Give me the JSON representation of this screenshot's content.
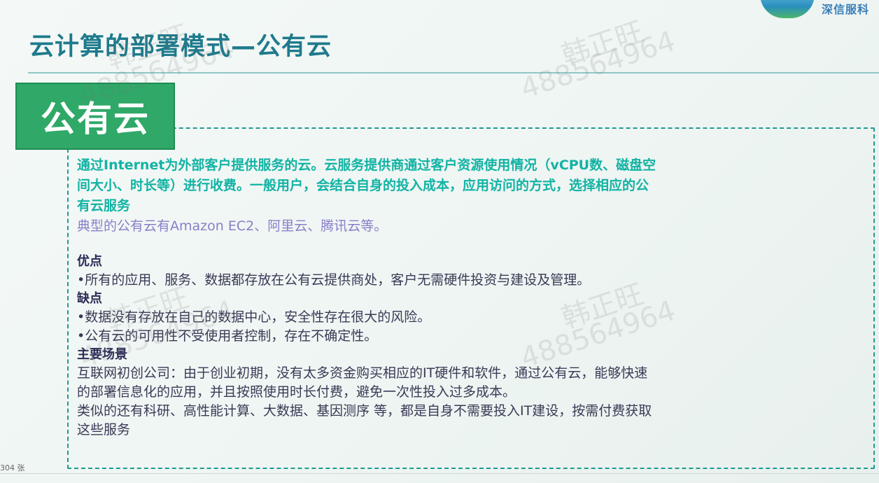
{
  "logo": {
    "text": "深信服科"
  },
  "slide": {
    "title": "云计算的部署模式—公有云",
    "tag": "公有云",
    "intro_lines": [
      "通过Internet为外部客户提供服务的云。云服务提供商通过客户资源使用情况（vCPU数、磁盘空",
      "间大小、时长等）进行收费。一般用户，会结合自身的投入成本，应用访问的方式，选择相应的公",
      "有云服务"
    ],
    "typical": "典型的公有云有Amazon EC2、阿里云、腾讯云等。",
    "pros_label": "优点",
    "pros": [
      "•所有的应用、服务、数据都存放在公有云提供商处，客户无需硬件投资与建设及管理。"
    ],
    "cons_label": "缺点",
    "cons": [
      "•数据没有存放在自己的数据中心，安全性存在很大的风险。",
      "•公有云的可用性不受使用者控制，存在不确定性。"
    ],
    "scenario_label": "主要场景",
    "scenario_lines": [
      "互联网初创公司：由于创业初期，没有太多资金购买相应的IT硬件和软件，通过公有云，能够快速",
      "的部署信息化的应用，并且按照使用时长付费，避免一次性投入过多成本。",
      "类似的还有科研、高性能计算、大数据、基因测序 等，都是自身不需要投入IT建设，按需付费获取",
      "这些服务"
    ]
  },
  "footer": {
    "page": "304 张"
  },
  "watermarks": [
    "韩正旺",
    "488564964",
    "韩正旺",
    "488564964",
    "韩正旺",
    "488564964",
    "韩正旺",
    "488564964"
  ]
}
